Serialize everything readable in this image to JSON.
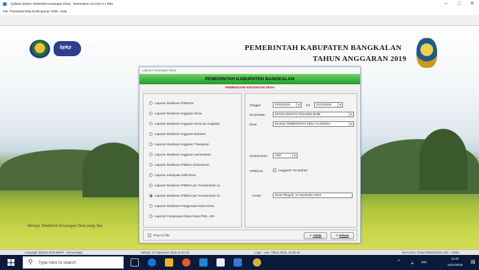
{
  "window": {
    "title": "Aplikasi Sistem Tatakelola Keuangan Desa - SisKeuDes V2.0.R2.0.1 Rilis",
    "controls": {
      "minimize": "–",
      "maximize": "□",
      "close": "✕"
    }
  },
  "menu": [
    "File",
    "Parameter",
    "Data Entri",
    "Laporan",
    "Tools",
    "Help"
  ],
  "header": {
    "line1": "PEMERINTAH KABUPATEN BANGKALAN",
    "line2": "TAHUN ANGGARAN 2019",
    "logo_text": "bpkp",
    "motto": "Menuju Tatakelola Keuangan Desa yang Aku"
  },
  "dialog": {
    "caption": "Laporan Keuangan Desa",
    "title": "PEMERINTAH KABUPATEN BANGKALAN",
    "subtitle": "PEMBUKUAN KEUANGAN DESA",
    "reports": [
      {
        "label": "Laporan Realisasi APBDesa",
        "selected": false
      },
      {
        "label": "Laporan Realisasi Anggaran Desa",
        "selected": false
      },
      {
        "label": "Laporan Realisasi Anggaran Desa per Kegiatan",
        "selected": false
      },
      {
        "label": "Laporan Realisasi Anggaran Bulanan",
        "selected": false
      },
      {
        "label": "Laporan Realisasi Anggaran Triwulanan",
        "selected": false
      },
      {
        "label": "Laporan Realisasi Anggaran Semesteran",
        "selected": false
      },
      {
        "label": "Laporan Realisasi APBDes Semesteran",
        "selected": false
      },
      {
        "label": "Laporan Kekayaan Milik Desa",
        "selected": false
      },
      {
        "label": "Laporan Realisasi APBDes per Sumberdana 1a",
        "selected": false
      },
      {
        "label": "Laporan Realisasi APBDes per Sumberdana 1b",
        "selected": true
      },
      {
        "label": "Laporan Realisasi Penggunaan Dana Desa",
        "selected": false
      },
      {
        "label": "Laporan Penyerapan Dana Desa PMK. 225",
        "selected": false
      }
    ],
    "form": {
      "tanggal_label": "Tanggal",
      "date_from": "01/01/2019",
      "sd_label": "s/d",
      "date_to": "31/12/2019",
      "kecamatan_label": "Kecamatan",
      "kecamatan": "09 KECAMATAN TANJUNG BUMI",
      "desa_label": "Desa",
      "desa": "09.2011  PEMERINTAH DESA TLANGOH",
      "sumberdana_label": "Sumberdana",
      "sumberdana": "ADD",
      "apbdesa_label": "APBDesa",
      "perubahan_label": "Anggaran Perubahan",
      "footer_label": "Footer",
      "footer": "Desa Tlangoh, 12 November 2019"
    },
    "print_to_file": "Print To File",
    "cetak": "Cetak",
    "keluar": "Keluar"
  },
  "status": {
    "copyright": "Copyright @2015-2019 BPKP - Kemendagri",
    "date": "Selasa, 12 Nopember 2019  11.02.33",
    "login": "Login : user,  Tahun 2019, 10.58.46",
    "db": "MsAccess: DataAPBDES2016.mde - ODBC"
  },
  "taskbar": {
    "search_placeholder": "Type here to search",
    "lang": "IND",
    "time": "11.02",
    "date": "12/11/2019"
  },
  "colors": {
    "dialog_bar": "#2fb03a",
    "subtitle_red": "#c0141a",
    "taskbar": "#0c1a3a"
  }
}
